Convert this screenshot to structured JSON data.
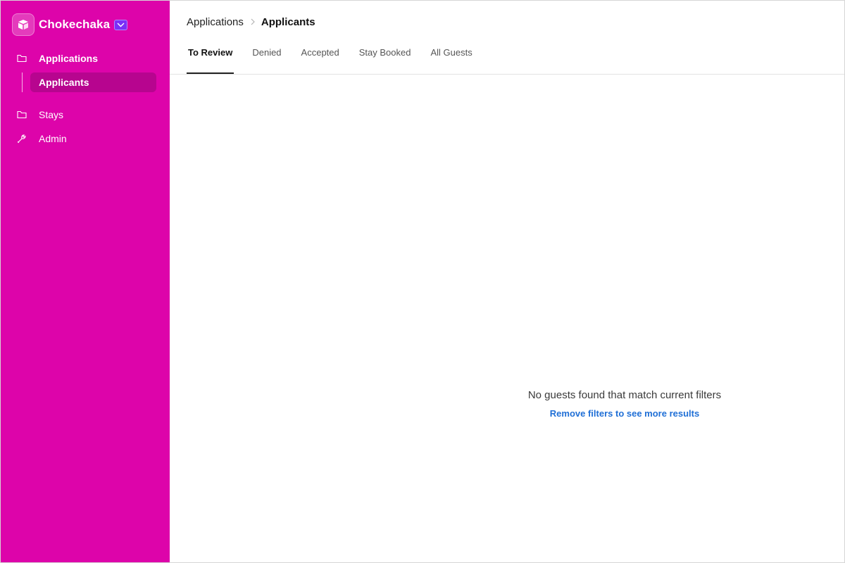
{
  "app": {
    "name": "Chokechaka",
    "logo_icon": "cube-icon",
    "menu_icon": "chevron-down-icon",
    "colors": {
      "sidebar": "#dd04aa",
      "sidebar_active": "#b7058f",
      "link": "#1f6fd6"
    }
  },
  "sidebar": {
    "items": [
      {
        "label": "Applications",
        "icon": "folder-icon",
        "active": true
      },
      {
        "label": "Applicants",
        "icon": "",
        "active": true,
        "sub": true
      },
      {
        "label": "Stays",
        "icon": "folder-icon",
        "active": false
      },
      {
        "label": "Admin",
        "icon": "wrench-icon",
        "active": false
      }
    ]
  },
  "breadcrumb": {
    "parent": "Applications",
    "current": "Applicants"
  },
  "tabs": [
    {
      "label": "To Review",
      "active": true
    },
    {
      "label": "Denied",
      "active": false
    },
    {
      "label": "Accepted",
      "active": false
    },
    {
      "label": "Stay Booked",
      "active": false
    },
    {
      "label": "All Guests",
      "active": false
    }
  ],
  "empty_state": {
    "message": "No guests found that match current filters",
    "action": "Remove filters to see more results"
  }
}
